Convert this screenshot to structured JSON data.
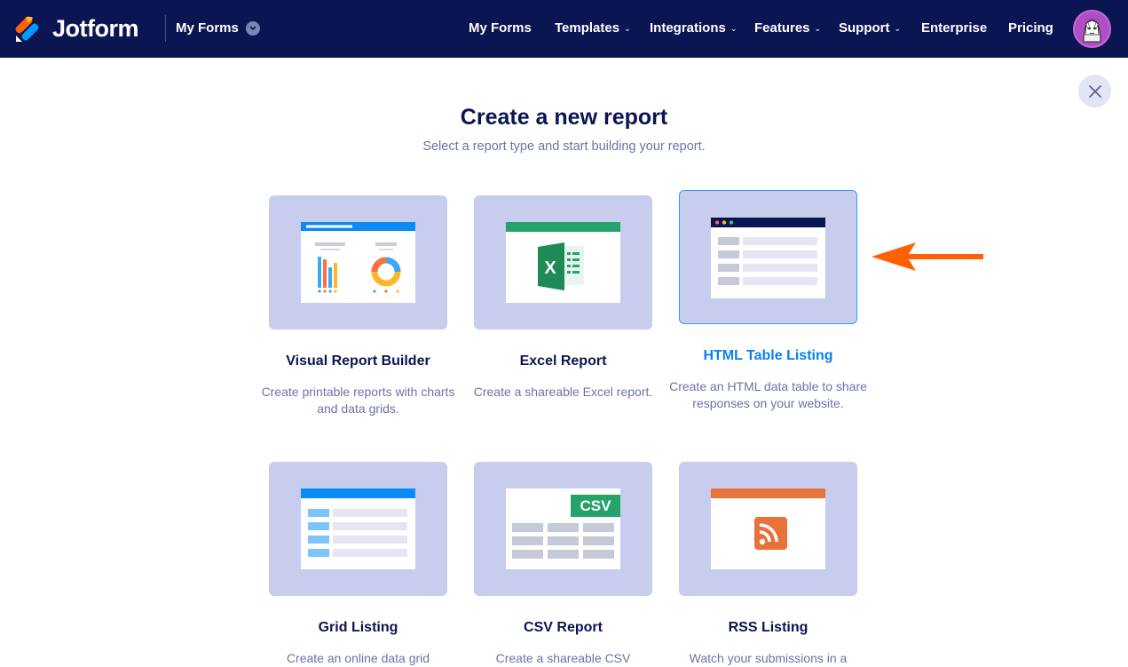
{
  "header": {
    "brand": "Jotform",
    "switcher_label": "My Forms",
    "nav": [
      {
        "label": "My Forms",
        "has_dropdown": false
      },
      {
        "label": "Templates",
        "has_dropdown": true
      },
      {
        "label": "Integrations",
        "has_dropdown": true
      },
      {
        "label": "Features",
        "has_dropdown": true
      },
      {
        "label": "Support",
        "has_dropdown": true
      },
      {
        "label": "Enterprise",
        "has_dropdown": false
      },
      {
        "label": "Pricing",
        "has_dropdown": false
      }
    ]
  },
  "page": {
    "title": "Create a new report",
    "subtitle": "Select a report type and start building your report."
  },
  "cards": [
    {
      "title": "Visual Report Builder",
      "desc": "Create printable reports with charts and data grids.",
      "icon": "visual-report-illustration"
    },
    {
      "title": "Excel Report",
      "desc": "Create a shareable Excel report.",
      "icon": "excel-illustration"
    },
    {
      "title": "HTML Table Listing",
      "desc": "Create an HTML data table to share responses on your website.",
      "icon": "html-table-illustration",
      "selected": true
    },
    {
      "title": "Grid Listing",
      "desc": "Create an online data grid",
      "icon": "grid-listing-illustration"
    },
    {
      "title": "CSV Report",
      "desc": "Create a shareable CSV",
      "icon": "csv-illustration",
      "badge": "CSV"
    },
    {
      "title": "RSS Listing",
      "desc": "Watch your submissions in a",
      "icon": "rss-illustration"
    }
  ],
  "colors": {
    "header_bg": "#0a1551",
    "tile_bg": "#c8cdee",
    "accent_blue": "#0a7ff0",
    "arrow_orange": "#ff6100",
    "excel_green": "#26a36b",
    "rss_orange": "#e8733a"
  }
}
